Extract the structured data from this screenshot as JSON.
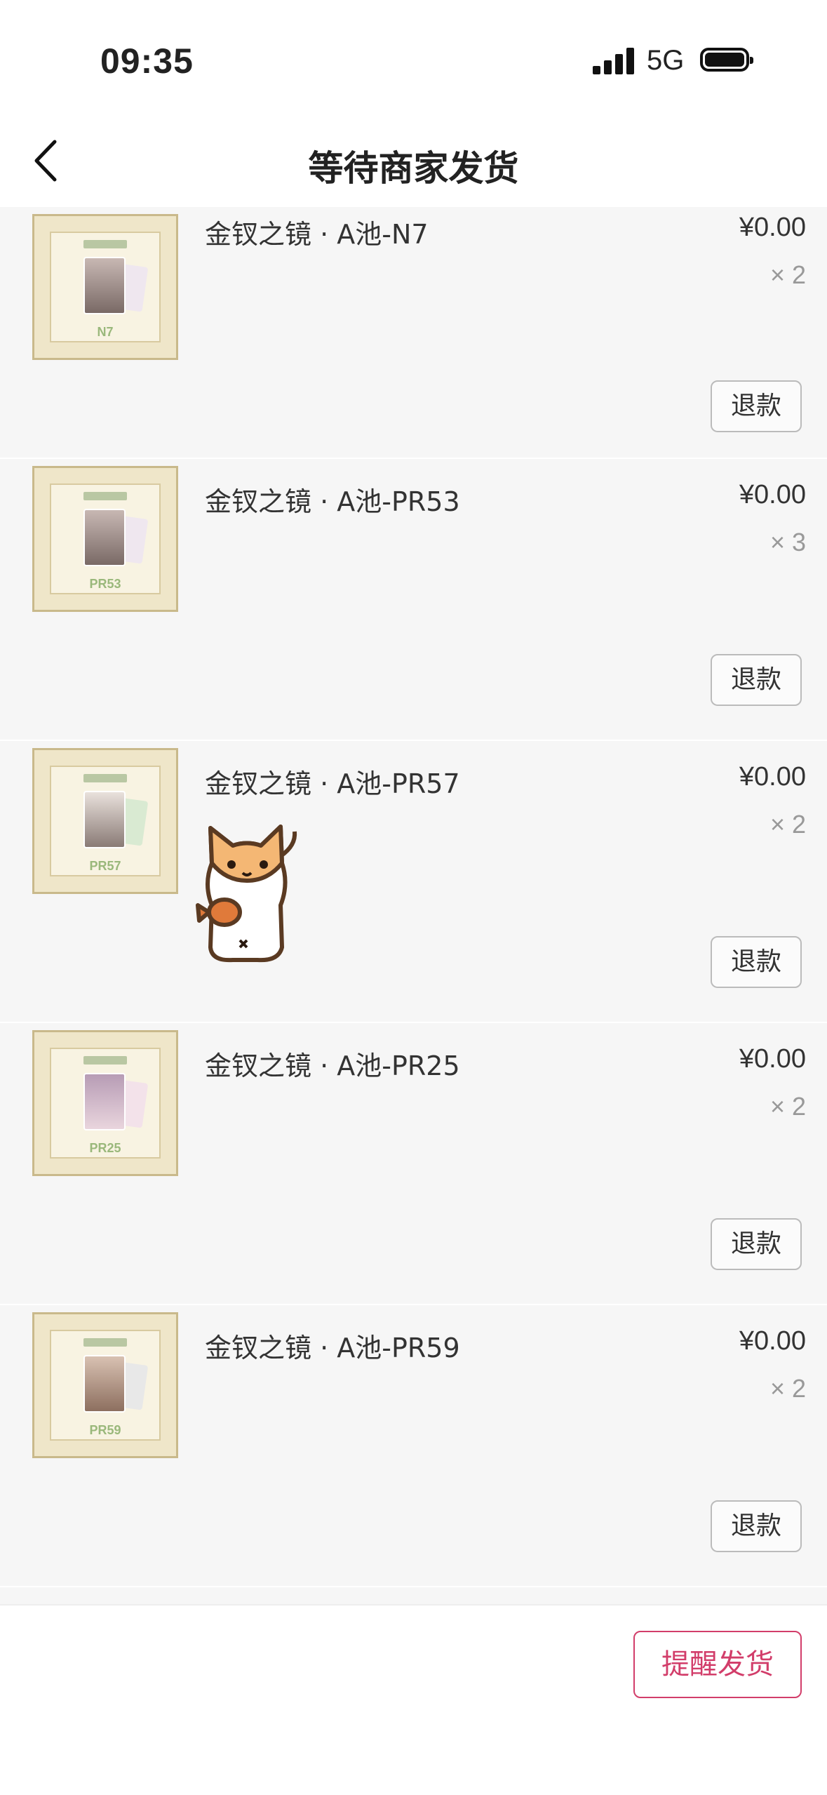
{
  "status_bar": {
    "time": "09:35",
    "network": "5G"
  },
  "nav": {
    "title": "等待商家发货"
  },
  "items": [
    {
      "name": "金钗之镜 · A池-N7",
      "price": "¥0.00",
      "qty": "× 2",
      "refund_label": "退款",
      "code": "N7"
    },
    {
      "name": "金钗之镜 · A池-PR53",
      "price": "¥0.00",
      "qty": "× 3",
      "refund_label": "退款",
      "code": "PR53"
    },
    {
      "name": "金钗之镜 · A池-PR57",
      "price": "¥0.00",
      "qty": "× 2",
      "refund_label": "退款",
      "code": "PR57"
    },
    {
      "name": "金钗之镜 · A池-PR25",
      "price": "¥0.00",
      "qty": "× 2",
      "refund_label": "退款",
      "code": "PR25"
    },
    {
      "name": "金钗之镜 · A池-PR59",
      "price": "¥0.00",
      "qty": "× 2",
      "refund_label": "退款",
      "code": "PR59"
    }
  ],
  "footer": {
    "remind_label": "提醒发货"
  },
  "colors": {
    "accent": "#d23d6a",
    "background": "#f6f6f6"
  }
}
